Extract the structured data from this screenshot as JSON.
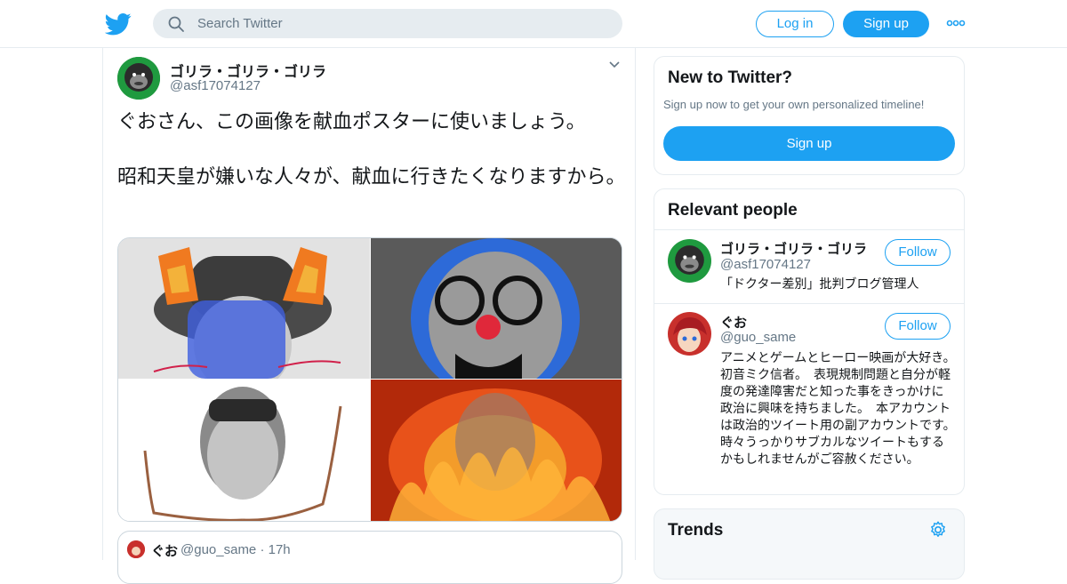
{
  "header": {
    "search_placeholder": "Search Twitter",
    "login_label": "Log in",
    "signup_label": "Sign up",
    "brand_color": "#1da1f2"
  },
  "tweet": {
    "author_name": "ゴリラ・ゴリラ・ゴリラ",
    "author_handle": "@asf17074127",
    "text": "ぐおさん、この画像を献血ポスターに使いましょう。\n\n昭和天皇が嫌いな人々が、献血に行きたくなりますから。",
    "quote": {
      "name": "ぐお",
      "handle_time": "@guo_same · 17h"
    }
  },
  "sidebar": {
    "new_to_twitter": {
      "title": "New to Twitter?",
      "subtitle": "Sign up now to get your own personalized timeline!",
      "signup_label": "Sign up"
    },
    "relevant_people": {
      "title": "Relevant people",
      "people": [
        {
          "name": "ゴリラ・ゴリラ・ゴリラ",
          "handle": "@asf17074127",
          "bio": "「ドクター差別」批判ブログ管理人",
          "follow_label": "Follow"
        },
        {
          "name": "ぐお",
          "handle": "@guo_same",
          "bio": "アニメとゲームとヒーロー映画が大好き。　初音ミク信者。　表現規制問題と自分が軽度の発達障害だと知った事をきっかけに政治に興味を持ちました。　本アカウントは政治的ツイート用の副アカウントです。　時々うっかりサブカルなツイートもするかもしれませんがご容赦ください。",
          "follow_label": "Follow"
        }
      ]
    },
    "trends": {
      "title": "Trends"
    }
  }
}
